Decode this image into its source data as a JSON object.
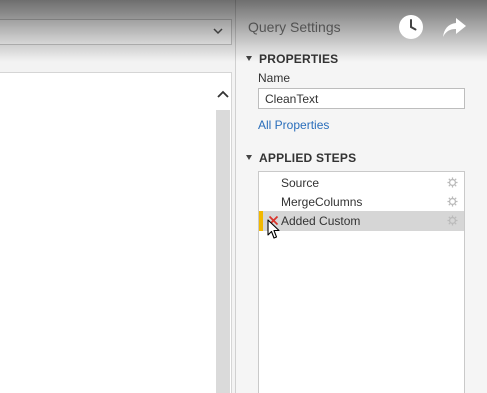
{
  "panel": {
    "title": "Query Settings",
    "properties_header": "PROPERTIES",
    "name_label": "Name",
    "name_value": "CleanText",
    "all_properties_link": "All Properties",
    "applied_steps_header": "APPLIED STEPS"
  },
  "steps": [
    {
      "label": "Source"
    },
    {
      "label": "MergeColumns"
    },
    {
      "label": "Added Custom"
    }
  ],
  "colors": {
    "selected_row": "#d6d6d6",
    "step_marker": "#f2b800",
    "link": "#2a6ebb",
    "error_x": "#d9342b"
  },
  "overlay_icons": [
    "clock-icon",
    "share-icon"
  ]
}
